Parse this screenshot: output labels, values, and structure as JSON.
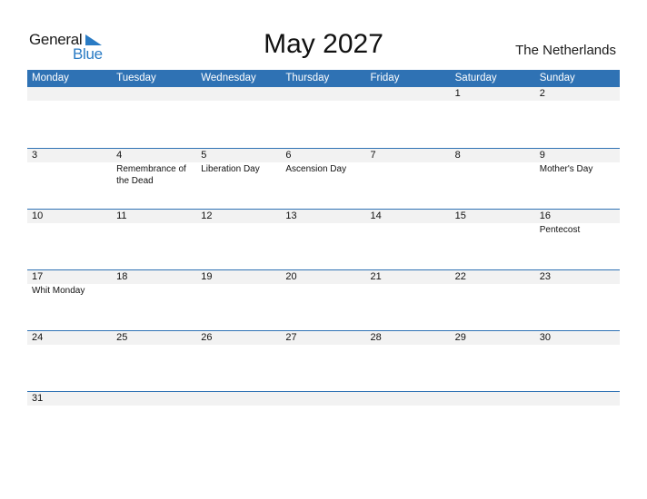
{
  "logo": {
    "word1": "General",
    "word2": "Blue"
  },
  "title": "May 2027",
  "country": "The Netherlands",
  "colors": {
    "accent": "#2f72b4",
    "band": "#f2f2f2",
    "logo_blue": "#2a7bc4"
  },
  "weekdays": [
    "Monday",
    "Tuesday",
    "Wednesday",
    "Thursday",
    "Friday",
    "Saturday",
    "Sunday"
  ],
  "weeks": [
    [
      {
        "day": "",
        "holiday": ""
      },
      {
        "day": "",
        "holiday": ""
      },
      {
        "day": "",
        "holiday": ""
      },
      {
        "day": "",
        "holiday": ""
      },
      {
        "day": "",
        "holiday": ""
      },
      {
        "day": "1",
        "holiday": ""
      },
      {
        "day": "2",
        "holiday": ""
      }
    ],
    [
      {
        "day": "3",
        "holiday": ""
      },
      {
        "day": "4",
        "holiday": "Remembrance of the Dead"
      },
      {
        "day": "5",
        "holiday": "Liberation Day"
      },
      {
        "day": "6",
        "holiday": "Ascension Day"
      },
      {
        "day": "7",
        "holiday": ""
      },
      {
        "day": "8",
        "holiday": ""
      },
      {
        "day": "9",
        "holiday": "Mother's Day"
      }
    ],
    [
      {
        "day": "10",
        "holiday": ""
      },
      {
        "day": "11",
        "holiday": ""
      },
      {
        "day": "12",
        "holiday": ""
      },
      {
        "day": "13",
        "holiday": ""
      },
      {
        "day": "14",
        "holiday": ""
      },
      {
        "day": "15",
        "holiday": ""
      },
      {
        "day": "16",
        "holiday": "Pentecost"
      }
    ],
    [
      {
        "day": "17",
        "holiday": "Whit Monday"
      },
      {
        "day": "18",
        "holiday": ""
      },
      {
        "day": "19",
        "holiday": ""
      },
      {
        "day": "20",
        "holiday": ""
      },
      {
        "day": "21",
        "holiday": ""
      },
      {
        "day": "22",
        "holiday": ""
      },
      {
        "day": "23",
        "holiday": ""
      }
    ],
    [
      {
        "day": "24",
        "holiday": ""
      },
      {
        "day": "25",
        "holiday": ""
      },
      {
        "day": "26",
        "holiday": ""
      },
      {
        "day": "27",
        "holiday": ""
      },
      {
        "day": "28",
        "holiday": ""
      },
      {
        "day": "29",
        "holiday": ""
      },
      {
        "day": "30",
        "holiday": ""
      }
    ],
    [
      {
        "day": "31",
        "holiday": ""
      },
      {
        "day": "",
        "holiday": ""
      },
      {
        "day": "",
        "holiday": ""
      },
      {
        "day": "",
        "holiday": ""
      },
      {
        "day": "",
        "holiday": ""
      },
      {
        "day": "",
        "holiday": ""
      },
      {
        "day": "",
        "holiday": ""
      }
    ]
  ]
}
